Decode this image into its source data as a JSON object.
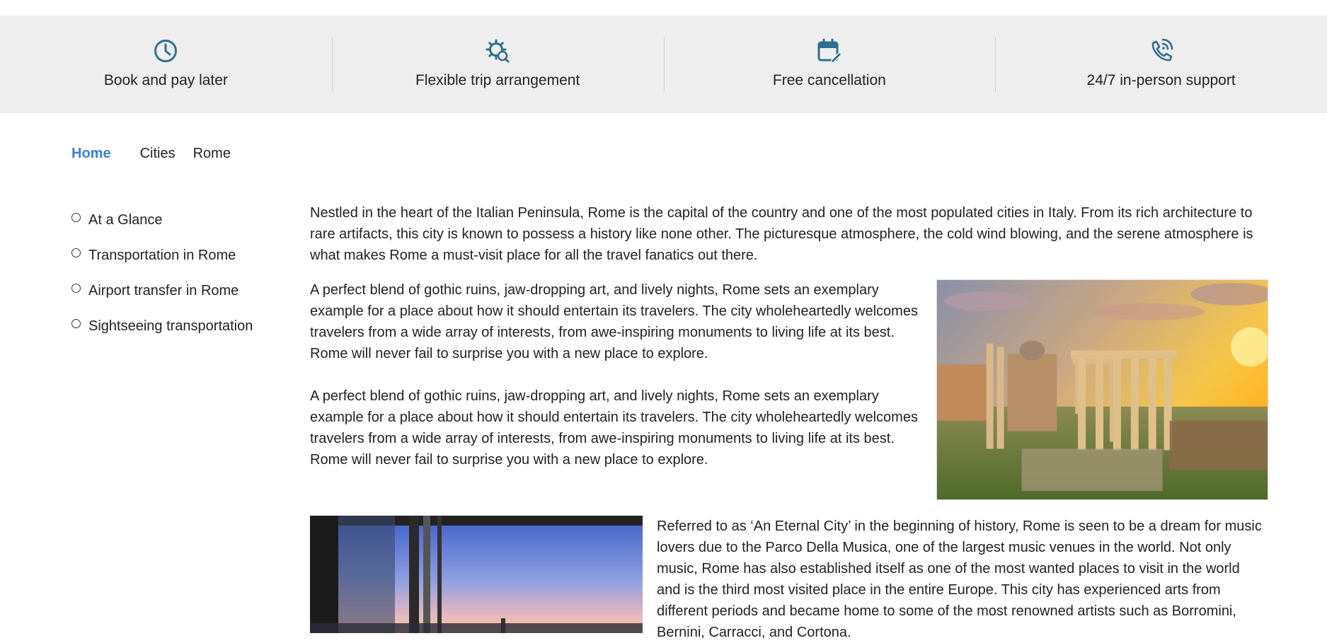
{
  "features": [
    {
      "icon": "clock-icon",
      "label": "Book and pay later"
    },
    {
      "icon": "gear-search-icon",
      "label": "Flexible trip arrangement"
    },
    {
      "icon": "calendar-edit-icon",
      "label": "Free cancellation"
    },
    {
      "icon": "phone-wifi-icon",
      "label": "24/7 in-person support"
    }
  ],
  "breadcrumb": {
    "home": "Home",
    "cities": "Cities",
    "current": "Rome"
  },
  "toc": [
    "At a Glance",
    "Transportation in Rome",
    "Airport transfer in Rome",
    "Sightseeing transportation"
  ],
  "content": {
    "p1": "Nestled in the heart of the Italian Peninsula, Rome is the capital of the country and one of the most populated cities in Italy. From its rich architecture to rare artifacts, this city is known to possess a history like none other. The picturesque atmosphere, the cold wind blowing, and the serene atmosphere is what makes Rome a must-visit place for all the travel fanatics out there.",
    "p2": "A perfect blend of gothic ruins, jaw-dropping art, and lively nights, Rome sets an exemplary example for a place about how it should entertain its travelers. The city wholeheartedly welcomes travelers from a wide array of interests, from awe-inspiring monuments to living life at its best. Rome will never fail to surprise you with a new place to explore.",
    "p3": "A perfect blend of gothic ruins, jaw-dropping art, and lively nights, Rome sets an exemplary example for a place about how it should entertain its travelers. The city wholeheartedly welcomes travelers from a wide array of interests, from awe-inspiring monuments to living life at its best. Rome will never fail to surprise you with a new place to explore.",
    "p4": "Referred to as ‘An Eternal City’ in the beginning of history, Rome is seen to be a dream for music lovers due to the Parco Della Musica, one of the largest music venues in the world. Not only music, Rome has also established itself as one of the most wanted places to visit in the world and is the third most visited place in the entire Europe. This city has experienced arts from different periods and became home to some of the most renowned artists such as Borromini, Bernini, Carracci, and Cortona."
  },
  "colors": {
    "accent": "#3b7ddd",
    "icon": "#2f6f8f",
    "band": "#eeeeee"
  }
}
